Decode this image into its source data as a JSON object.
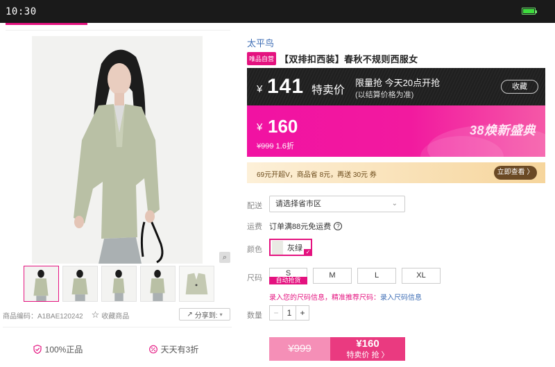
{
  "status_bar": {
    "time": "10:30",
    "battery_percent": 100
  },
  "gallery": {
    "product_code": "商品编码：A1BAE120242",
    "favorite_label": "收藏商品",
    "share_label": "分享到:"
  },
  "guarantees": [
    {
      "label": "100%正品"
    },
    {
      "label": "天天有3折"
    }
  ],
  "product": {
    "brand": "太平鸟",
    "self_badge": "唯品自营",
    "title": "【双排扣西装】春秋不规则西服女"
  },
  "flash_sale": {
    "currency": "¥",
    "price": "141",
    "label": "特卖价",
    "limit_text": "限量抢 今天20点开抢",
    "note": "(以结算价格为准)",
    "collect_button": "收藏"
  },
  "price_box": {
    "currency": "¥",
    "price": "160",
    "original": "¥999",
    "discount": "1.6折",
    "festival": "38焕新盛典"
  },
  "vip_bar": {
    "text": "69元开超V，商品省 8元，再送 30元 券",
    "button": "立即查看 〉"
  },
  "options": {
    "shipping_to_label": "配送",
    "region_placeholder": "请选择省市区",
    "freight_label": "运费",
    "freight_text": "订单满88元免运费",
    "color_label": "颜色",
    "color_value": "灰绿",
    "size_label": "尺码",
    "sizes": [
      "S",
      "M",
      "L",
      "XL"
    ],
    "size_s_tag": "自动抢货",
    "size_hint_prefix": "录入您的尺码信息，精准推荐尺码：",
    "size_hint_link": "录入尺码信息",
    "qty_label": "数量",
    "qty_value": "1"
  },
  "buy": {
    "original_price": "¥999",
    "price": "¥160",
    "button_label": "特卖价 抢 〉"
  },
  "colors": {
    "accent": "#e4127f",
    "brand_link": "#3d6db5"
  }
}
